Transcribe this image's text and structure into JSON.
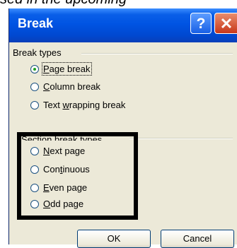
{
  "caption": "sed in the upcoming",
  "dialog": {
    "title": "Break",
    "help_glyph": "?",
    "close_glyph": "✕",
    "break_types": {
      "heading": "Break types",
      "options": [
        {
          "pre": "",
          "key": "P",
          "post": "age break",
          "selected": true
        },
        {
          "pre": "",
          "key": "C",
          "post": "olumn break",
          "selected": false
        },
        {
          "pre": "Text ",
          "key": "w",
          "post": "rapping break",
          "selected": false
        }
      ]
    },
    "section_break_types": {
      "heading": "Section break types",
      "options": [
        {
          "pre": "",
          "key": "N",
          "post": "ext page",
          "selected": false
        },
        {
          "pre": "Con",
          "key": "t",
          "post": "inuous",
          "selected": false
        },
        {
          "pre": "",
          "key": "E",
          "post": "ven page",
          "selected": false
        },
        {
          "pre": "",
          "key": "O",
          "post": "dd page",
          "selected": false
        }
      ]
    },
    "ok_label": "OK",
    "cancel_label": "Cancel"
  },
  "colors": {
    "titlebar": "#0054e3",
    "dialog_face": "#ece9d8",
    "radio_dot": "#21a121",
    "highlight_box": "#000000"
  }
}
